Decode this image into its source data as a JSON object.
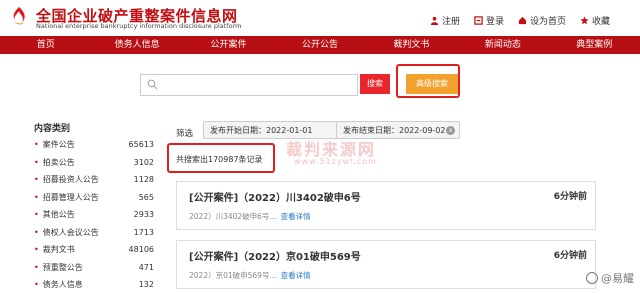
{
  "site": {
    "title": "全国企业破产重整案件信息网",
    "subtitle": "National enterprise bankruptcy information disclosure platform",
    "logo_icon": "flame-logo-icon"
  },
  "toplinks": [
    {
      "label": "注册",
      "icon": "user-icon"
    },
    {
      "label": "登录",
      "icon": "login-icon"
    },
    {
      "label": "设为首页",
      "icon": "home-icon"
    },
    {
      "label": "收藏",
      "icon": "star-icon"
    }
  ],
  "nav": [
    "首页",
    "债务人信息",
    "公开案件",
    "公开公告",
    "裁判文书",
    "新闻动态",
    "典型案例"
  ],
  "search": {
    "placeholder": "",
    "button_label": "搜索",
    "advanced_label": "高级搜索"
  },
  "sidebar": {
    "title": "内容类别",
    "items": [
      {
        "label": "案件公告",
        "count": "65613"
      },
      {
        "label": "拍卖公告",
        "count": "3102"
      },
      {
        "label": "招募投资人公告",
        "count": "1128"
      },
      {
        "label": "招募管理人公告",
        "count": "565"
      },
      {
        "label": "其他公告",
        "count": "2933"
      },
      {
        "label": "债权人会议公告",
        "count": "1713"
      },
      {
        "label": "裁判文书",
        "count": "48106"
      },
      {
        "label": "预重整公告",
        "count": "471"
      },
      {
        "label": "债务人信息",
        "count": "132"
      }
    ]
  },
  "filter": {
    "label": "筛选",
    "start_date": "发布开始日期：2022-01-01",
    "end_date": "发布结束日期：2022-09-02",
    "clear_icon": "x"
  },
  "result_count": "共搜索出170987条记录",
  "watermark": {
    "main": "裁判来源网",
    "url": "www.51zywl.com"
  },
  "results": [
    {
      "title": "[公开案件]（2022）川3402破申6号",
      "time": "6分钟前",
      "summary": "2022）川3402破申6号...",
      "link": "查看详情"
    },
    {
      "title": "[公开案件]（2022）京01破申569号",
      "time": "6分钟前",
      "summary": "2022）京01破申569号...",
      "link": "查看详情"
    }
  ],
  "corner_watermark": "@易耀"
}
